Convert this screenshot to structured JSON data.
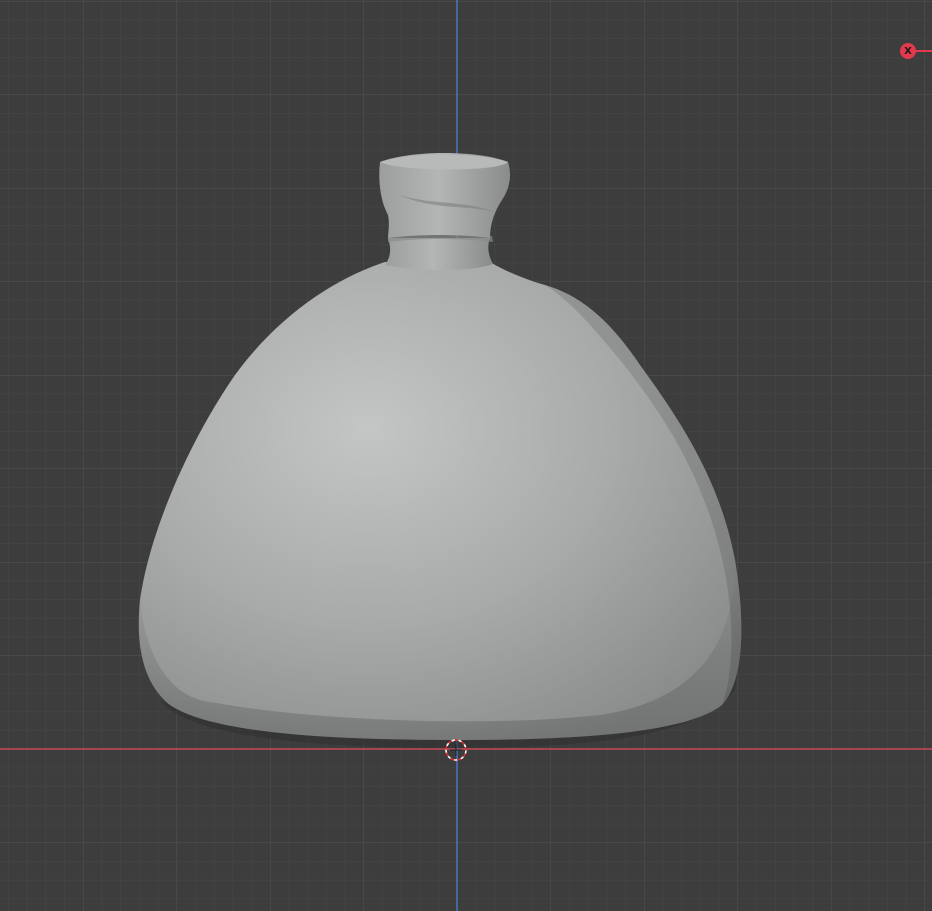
{
  "viewport": {
    "background": "#3d3d3d",
    "grid_minor_color": "#474747",
    "grid_major_color": "#525252",
    "x_axis_color": "#c84a55",
    "z_axis_color": "#4a78c8"
  },
  "object": {
    "name": "",
    "base_color": "#a3a5a5",
    "highlight_color": "#c4c6c6",
    "shadow_color": "#7d7f80"
  },
  "gizmo": {
    "x_axis_label": "X",
    "x_axis_color": "#e2394f"
  },
  "icons": {
    "origin": "origin-cursor-icon",
    "axis": "axis-gizmo-x-icon"
  }
}
